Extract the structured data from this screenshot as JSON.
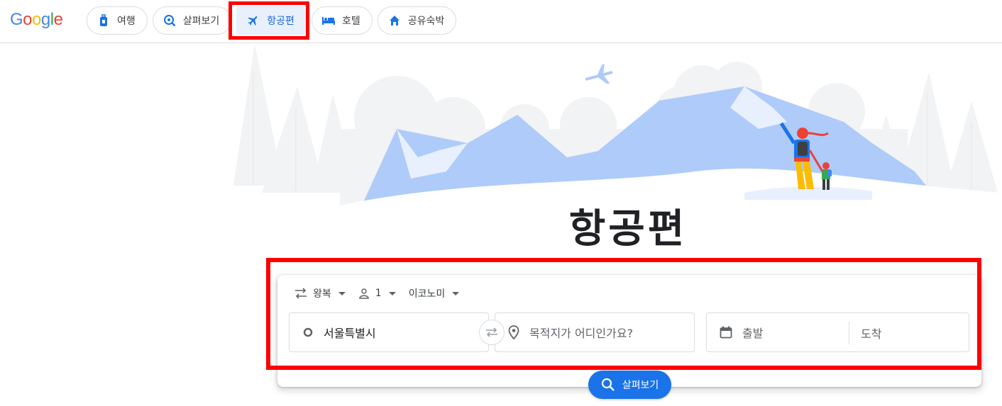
{
  "logo": {
    "text": "Google"
  },
  "nav": {
    "items": [
      {
        "label": "여행",
        "icon": "luggage-icon"
      },
      {
        "label": "살펴보기",
        "icon": "explore-search-icon"
      },
      {
        "label": "항공편",
        "icon": "flight-icon",
        "active": true
      },
      {
        "label": "호텔",
        "icon": "hotel-bed-icon"
      },
      {
        "label": "공유숙박",
        "icon": "home-icon"
      }
    ]
  },
  "hero": {
    "title": "항공편"
  },
  "search": {
    "trip_type": "왕복",
    "passengers": "1",
    "cabin_class": "이코노미",
    "origin": "서울특별시",
    "destination_placeholder": "목적지가 어디인가요?",
    "depart_placeholder": "출발",
    "return_placeholder": "도착",
    "button_label": "살펴보기"
  },
  "colors": {
    "accent": "#1a73e8",
    "active_chip_bg": "#e8f0fe",
    "highlight": "#ff0000",
    "mountain": "#aecbfa"
  }
}
